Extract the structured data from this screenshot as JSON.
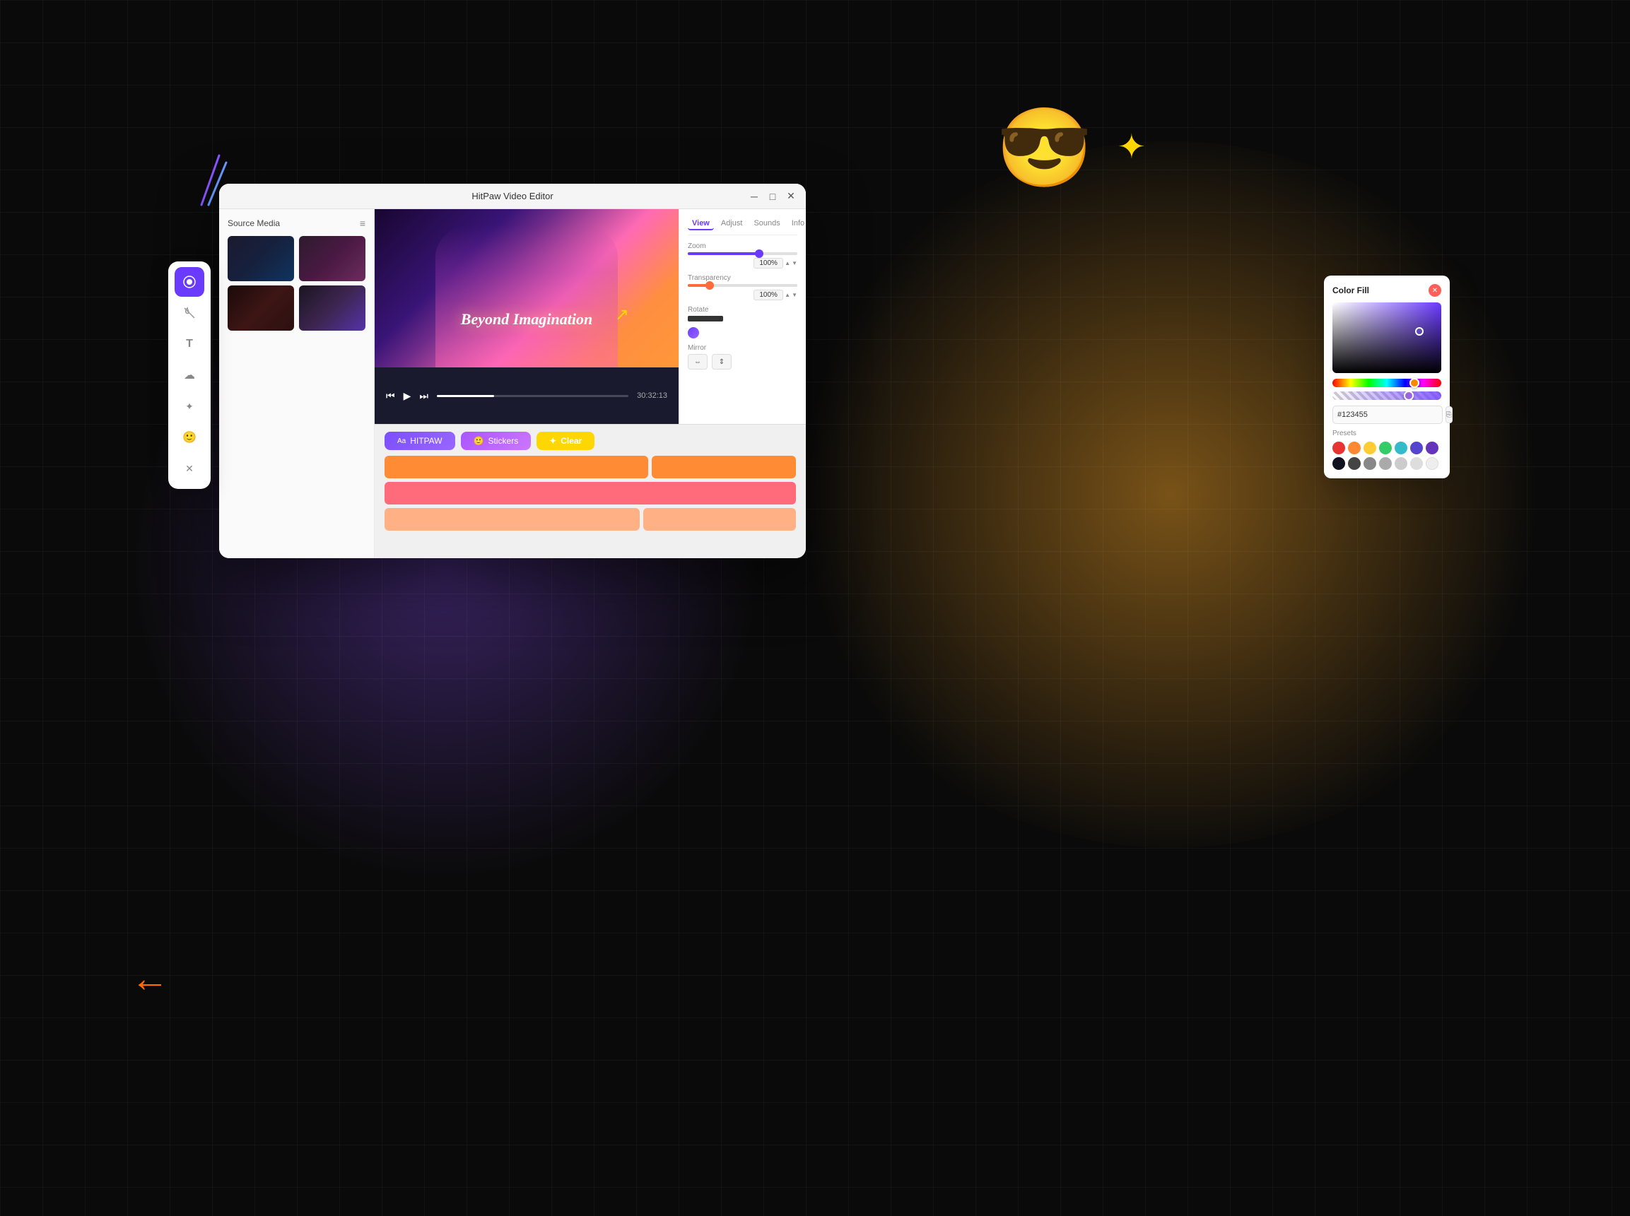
{
  "app": {
    "title": "HitPaw Video Editor",
    "window_controls": [
      "minimize",
      "maximize",
      "close"
    ]
  },
  "source_media": {
    "title": "Source Media",
    "icon": "≡"
  },
  "tabs": [
    {
      "label": "View",
      "active": true
    },
    {
      "label": "Adjust",
      "active": false
    },
    {
      "label": "Sounds",
      "active": false
    },
    {
      "label": "Info",
      "active": false
    }
  ],
  "properties": {
    "zoom_label": "Zoom",
    "zoom_value": "100%",
    "transparency_label": "Transparency",
    "transparency_value": "100%",
    "rotate_label": "Rotate",
    "mirror_label": "Mirror"
  },
  "timeline": {
    "btn_text": "HITPAW",
    "btn_sticker": "Stickers",
    "btn_clear": "Clear",
    "time": "30:32:13"
  },
  "color_fill": {
    "title": "Color Fill",
    "hex_value": "#123455",
    "presets_label": "Presets",
    "preset_colors": [
      "#E83333",
      "#FF8833",
      "#FFCC33",
      "#33CC66",
      "#33BBCC",
      "#5544CC",
      "#6633BB",
      "#111122",
      "#444444",
      "#888888",
      "#AAAAAA",
      "#CCCCCC",
      "#DDDDDD",
      "#EEEEEE"
    ]
  },
  "sidebar": {
    "tools": [
      {
        "icon": "⚙️",
        "name": "effects",
        "active": true
      },
      {
        "icon": "✂️",
        "name": "cut",
        "active": false
      },
      {
        "icon": "T",
        "name": "text",
        "active": false
      },
      {
        "icon": "☁️",
        "name": "elements",
        "active": false
      },
      {
        "icon": "✨",
        "name": "ai",
        "active": false
      },
      {
        "icon": "😊",
        "name": "emoji",
        "active": false
      },
      {
        "icon": "⊠",
        "name": "more",
        "active": false
      }
    ]
  },
  "video": {
    "text_overlay": "Beyond Imagination"
  }
}
